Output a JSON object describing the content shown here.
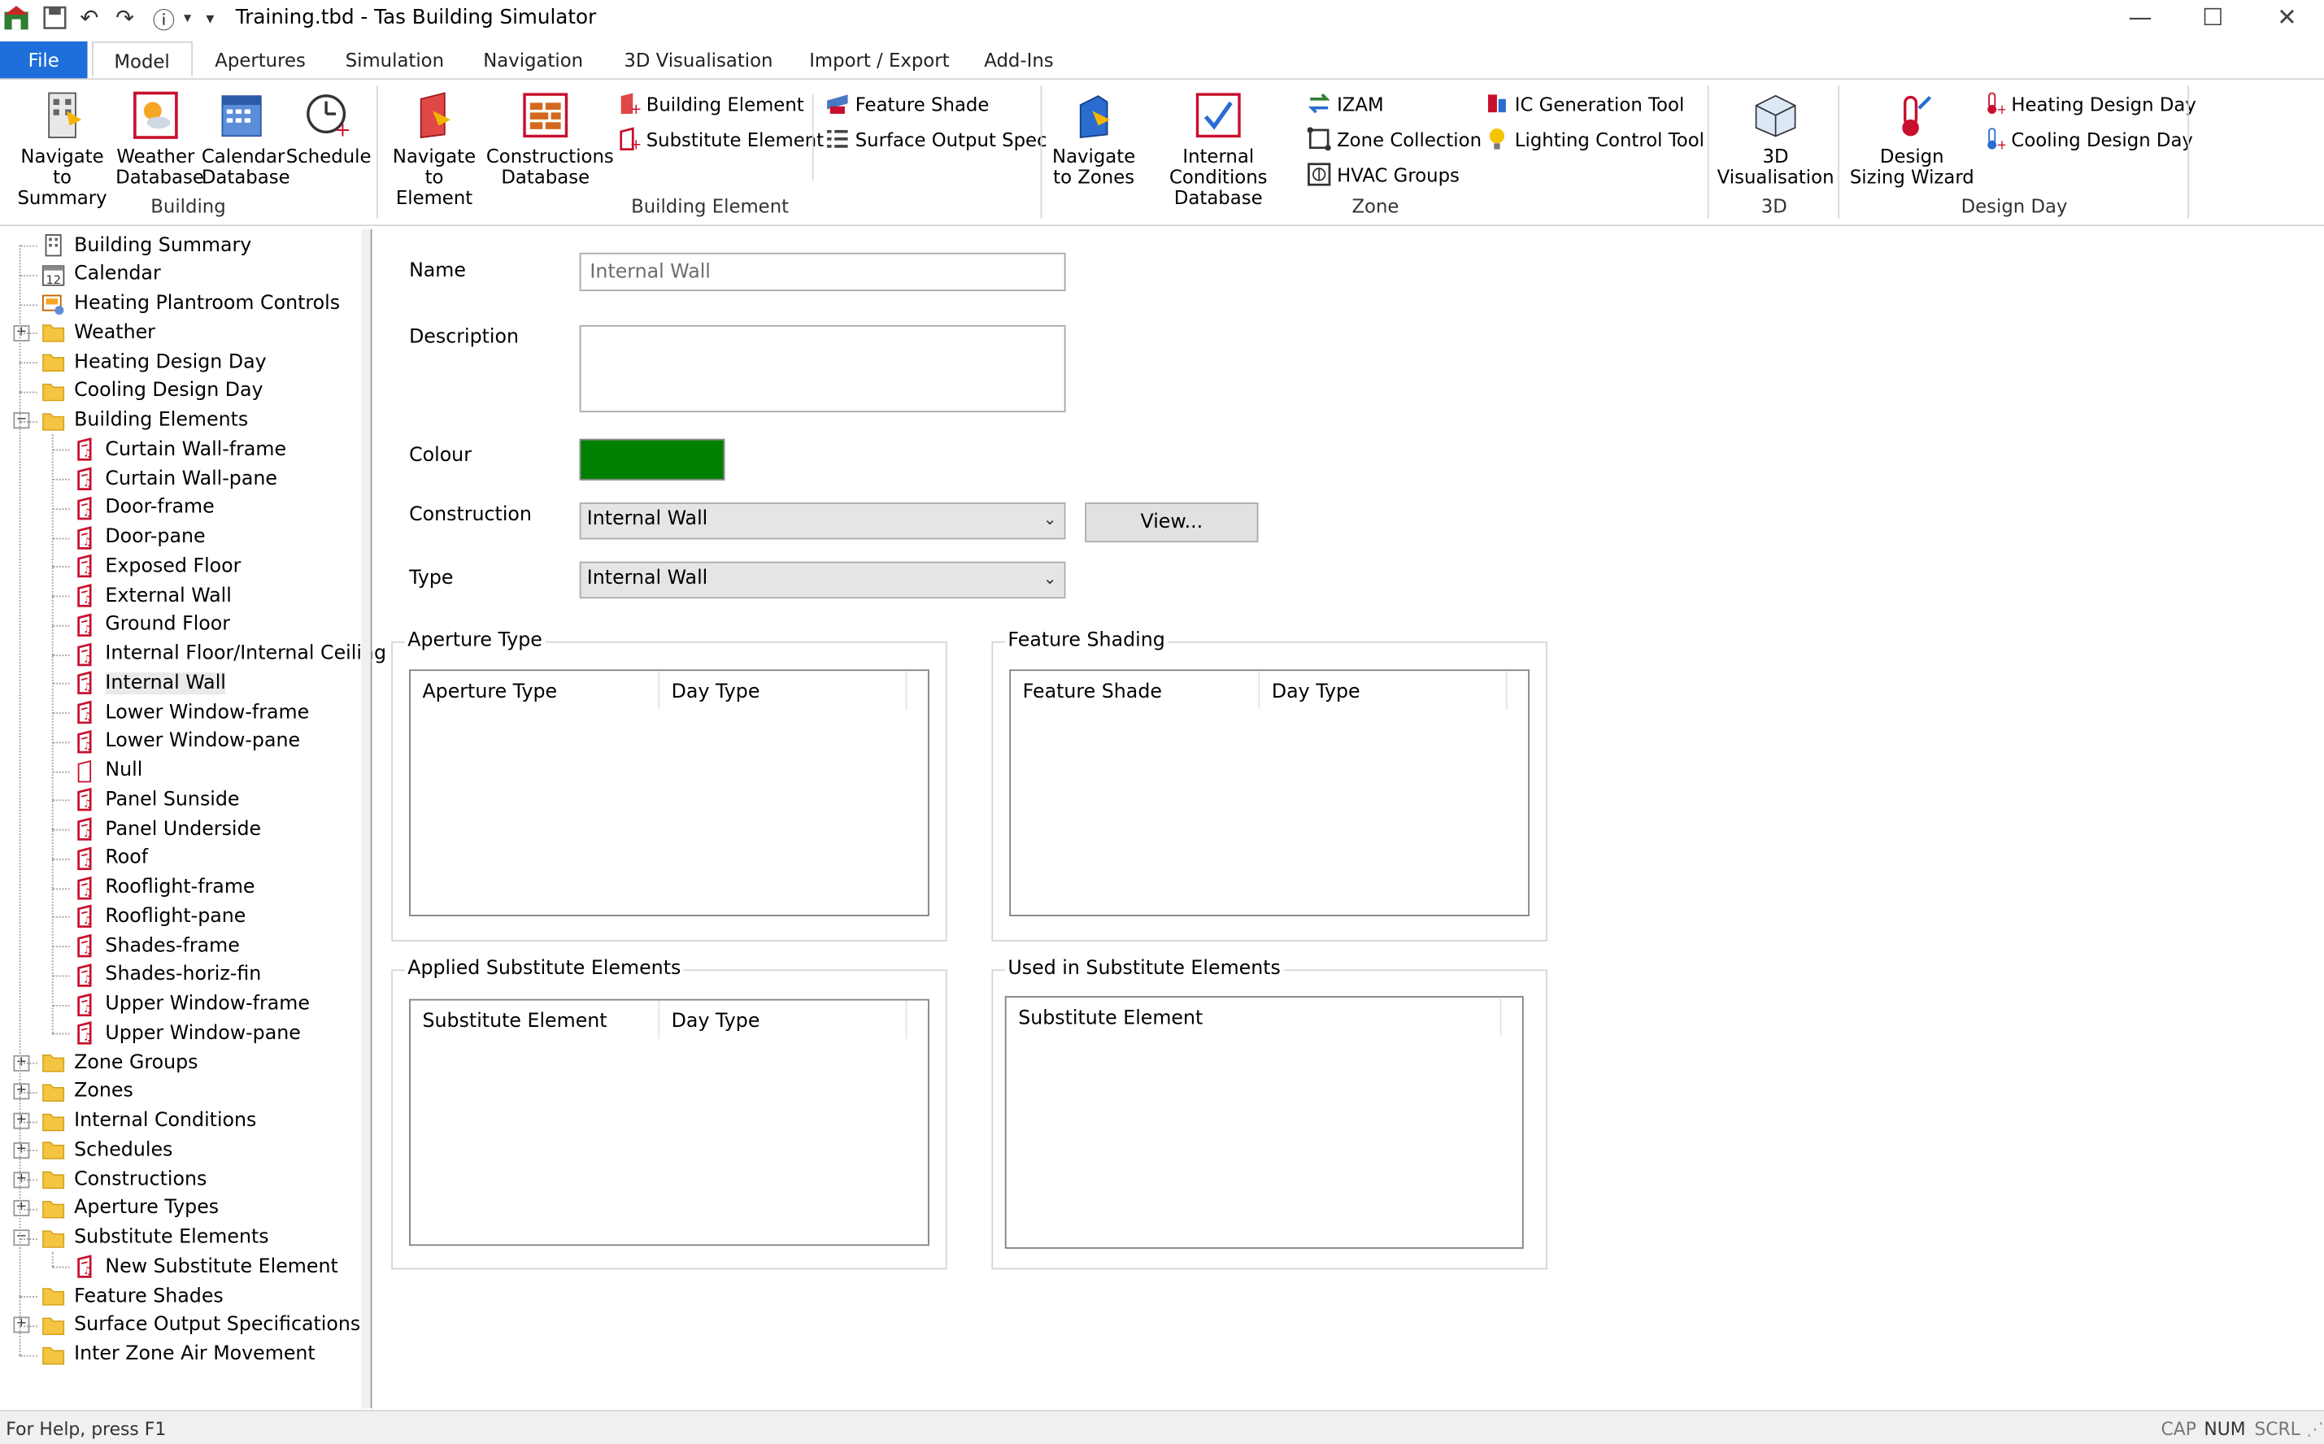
{
  "window": {
    "title": "Training.tbd - Tas Building Simulator",
    "controls": [
      "minimize-icon",
      "maximize-icon",
      "close-icon"
    ]
  },
  "tabs": [
    {
      "label": "File"
    },
    {
      "label": "Model"
    },
    {
      "label": "Apertures"
    },
    {
      "label": "Simulation"
    },
    {
      "label": "Navigation"
    },
    {
      "label": "3D Visualisation"
    },
    {
      "label": "Import / Export"
    },
    {
      "label": "Add-Ins"
    }
  ],
  "ribbon": {
    "building": {
      "group_label": "Building",
      "navigate_summary": [
        "Navigate to",
        "Summary"
      ],
      "weather_db": [
        "Weather",
        "Database"
      ],
      "calendar_db": [
        "Calendar",
        "Database"
      ],
      "schedule": [
        "Schedule"
      ]
    },
    "building_element": {
      "group_label": "Building Element",
      "navigate_element": [
        "Navigate",
        "to Element"
      ],
      "constructions_db": [
        "Constructions",
        "Database"
      ],
      "building_element": "Building Element",
      "substitute_element": "Substitute Element",
      "feature_shade": "Feature Shade",
      "surface_output_spec": "Surface Output Spec"
    },
    "zone": {
      "group_label": "Zone",
      "navigate_zones": [
        "Navigate",
        "to Zones"
      ],
      "internal_conditions_db": [
        "Internal Conditions",
        "Database"
      ],
      "izam": "IZAM",
      "zone_collection": "Zone Collection",
      "hvac_groups": "HVAC Groups",
      "ic_generation_tool": "IC Generation Tool",
      "lighting_control_tool": "Lighting Control Tool"
    },
    "three_d": {
      "group_label": "3D",
      "visualisation": [
        "3D",
        "Visualisation"
      ]
    },
    "design_day": {
      "group_label": "Design Day",
      "design_sizing_wizard": [
        "Design",
        "Sizing Wizard"
      ],
      "heating_design_day": "Heating Design Day",
      "cooling_design_day": "Cooling Design Day"
    }
  },
  "tree": {
    "top_items": [
      {
        "label": "Building Summary",
        "icon": "building-summary-icon"
      },
      {
        "label": "Calendar",
        "icon": "calendar-icon"
      },
      {
        "label": "Heating Plantroom Controls",
        "icon": "plantroom-icon"
      },
      {
        "label": "Weather",
        "icon": "folder-icon",
        "expand": "+"
      },
      {
        "label": "Heating Design Day",
        "icon": "folder-icon"
      },
      {
        "label": "Cooling Design Day",
        "icon": "folder-icon"
      },
      {
        "label": "Building Elements",
        "icon": "folder-icon",
        "expand": "−"
      }
    ],
    "element_children": [
      "Curtain Wall-frame",
      "Curtain Wall-pane",
      "Door-frame",
      "Door-pane",
      "Exposed Floor",
      "External Wall",
      "Ground Floor",
      "Internal Floor/Internal Ceiling",
      "Internal Wall",
      "Lower Window-frame",
      "Lower Window-pane",
      "Null",
      "Panel Sunside",
      "Panel Underside",
      "Roof",
      "Rooflight-frame",
      "Rooflight-pane",
      "Shades-frame",
      "Shades-horiz-fin",
      "Upper Window-frame",
      "Upper Window-pane"
    ],
    "selected_child": "Internal Wall",
    "bottom_items": [
      {
        "label": "Zone Groups",
        "expand": "+"
      },
      {
        "label": "Zones",
        "expand": "+"
      },
      {
        "label": "Internal Conditions",
        "expand": "+"
      },
      {
        "label": "Schedules",
        "expand": "+"
      },
      {
        "label": "Constructions",
        "expand": "+"
      },
      {
        "label": "Aperture Types",
        "expand": "+"
      },
      {
        "label": "Substitute Elements",
        "expand": "−"
      }
    ],
    "substitute_child": "New Substitute Element",
    "tail_items": [
      {
        "label": "Feature Shades",
        "expand": ""
      },
      {
        "label": "Surface Output Specifications",
        "expand": "+"
      },
      {
        "label": "Inter Zone Air Movement",
        "expand": ""
      }
    ]
  },
  "form": {
    "name_label": "Name",
    "name_value": "Internal Wall",
    "description_label": "Description",
    "description_value": "",
    "colour_label": "Colour",
    "colour_value": "#008000",
    "construction_label": "Construction",
    "construction_value": "Internal Wall",
    "view_button": "View...",
    "type_label": "Type",
    "type_value": "Internal Wall"
  },
  "groups": {
    "aperture_type": {
      "title": "Aperture Type",
      "col1": "Aperture Type",
      "col2": "Day Type"
    },
    "feature_shading": {
      "title": "Feature Shading",
      "col1": "Feature Shade",
      "col2": "Day Type"
    },
    "applied_substitute": {
      "title": "Applied Substitute Elements",
      "col1": "Substitute Element",
      "col2": "Day Type"
    },
    "used_in_substitute": {
      "title": "Used in Substitute Elements",
      "col1": "Substitute Element"
    }
  },
  "status": {
    "help": "For Help, press F1",
    "cap": "CAP",
    "num": "NUM",
    "scrl": "SCRL"
  },
  "colors": {
    "accent": "#1e6fd9",
    "element_icon": "#c8102e",
    "folder": "#f4c542"
  }
}
